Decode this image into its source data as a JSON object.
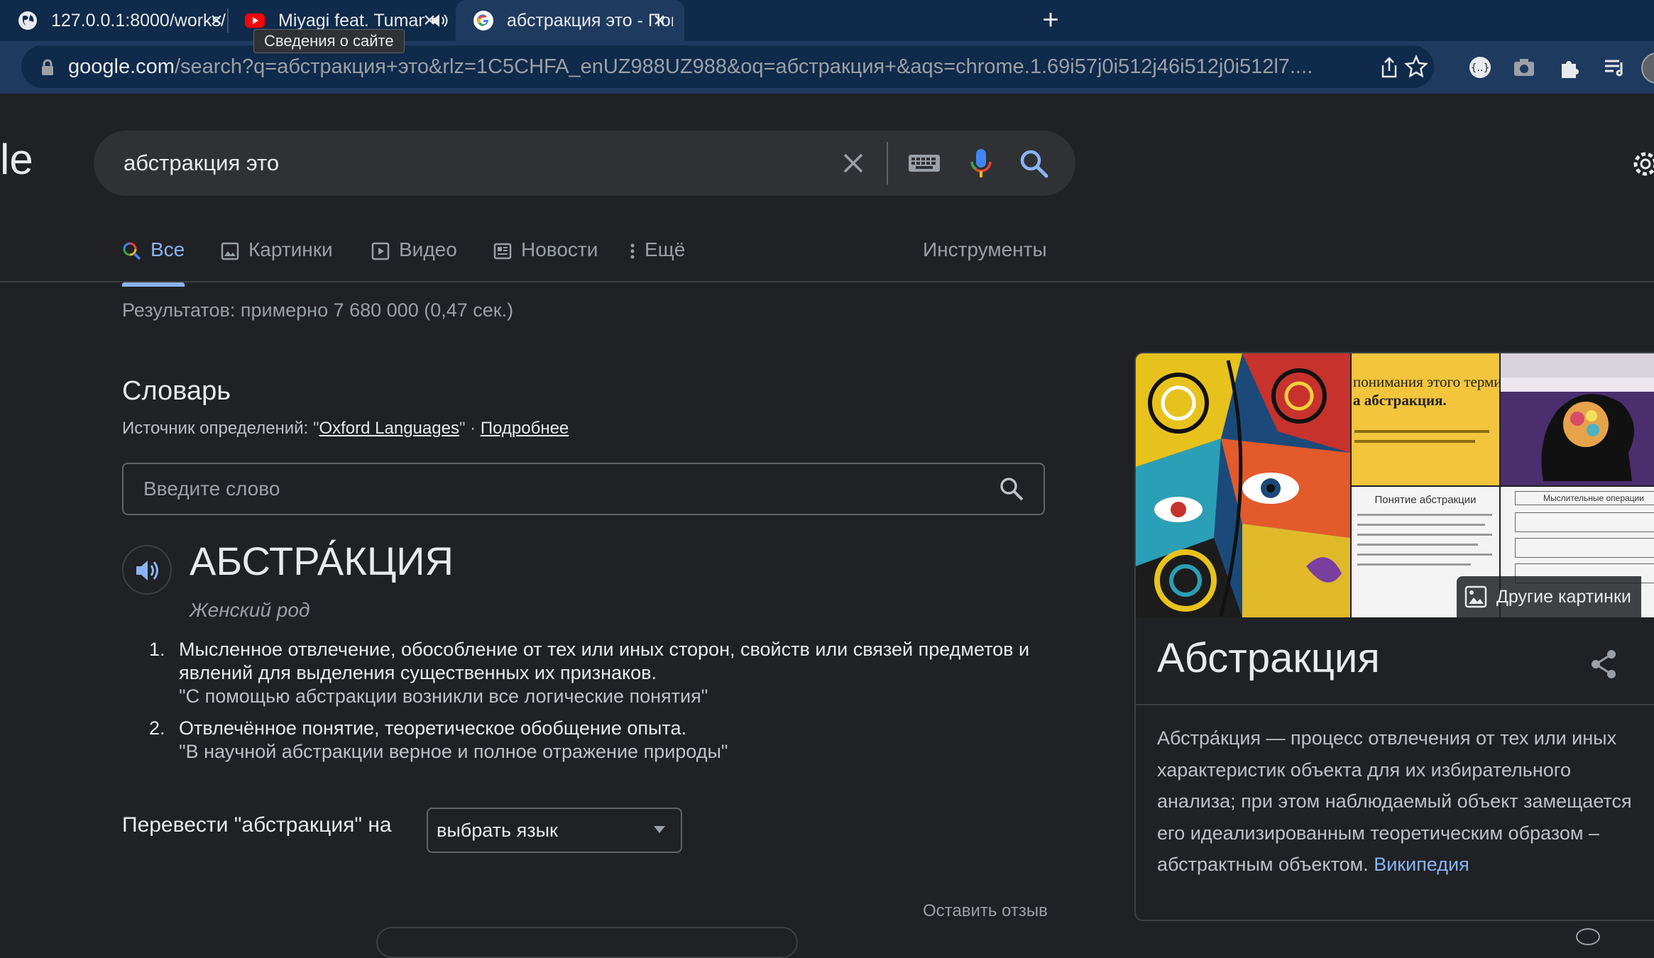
{
  "browser": {
    "tabs": [
      {
        "title": "127.0.0.1:8000/works/",
        "favicon": "globe-icon"
      },
      {
        "title": "Miyagi feat. TumaniYO, KAI",
        "favicon": "youtube-icon",
        "audio": "speaker-icon"
      },
      {
        "title": "абстракция это - Поиск в Google",
        "favicon": "google-icon",
        "active": true
      }
    ],
    "tooltip": "Сведения о сайте",
    "address_host": "google.com",
    "address_path": "/search?q=абстракция+это&rlz=1C5CHFA_enUZ988UZ988&oq=абстракция+&aqs=chrome.1.69i57j0i512j46i512j0i512l7...."
  },
  "search": {
    "logo_fragment": "le",
    "query": "абстракция это",
    "tabs": [
      {
        "label": "Все",
        "icon": "google-search-icon",
        "active": true
      },
      {
        "label": "Картинки",
        "icon": "image-icon"
      },
      {
        "label": "Видео",
        "icon": "play-icon"
      },
      {
        "label": "Новости",
        "icon": "news-icon"
      },
      {
        "label": "Ещё",
        "icon": "more-vert-icon"
      }
    ],
    "tools_label": "Инструменты",
    "result_stats": "Результатов: примерно 7 680 000 (0,47 сек.)"
  },
  "dictionary": {
    "title": "Словарь",
    "source_prefix": "Источник определений: \"",
    "source_link": "Oxford Languages",
    "source_suffix": "\" · ",
    "more_link": "Подробнее",
    "input_placeholder": "Введите слово",
    "headword": "АБСТРА́КЦИЯ",
    "gender": "Женский род",
    "definitions": [
      {
        "num": "1.",
        "text": "Мысленное отвлечение, обособление от тех или иных сторон, свойств или связей предметов и явлений для выделения существенных их признаков.",
        "example": "\"С помощью абстракции возникли все логические понятия\""
      },
      {
        "num": "2.",
        "text": "Отвлечённое понятие, теоретическое обобщение опыта.",
        "example": "\"В научной абстракции верное и полное отражение природы\""
      }
    ],
    "translate_label": "Перевести \"абстракция\" на",
    "language_select": "выбрать язык",
    "feedback": "Оставить отзыв"
  },
  "knowledge_panel": {
    "more_images": "Другие картинки",
    "image2_text": [
      "понимания этого терми",
      "а абстракция."
    ],
    "image4_text": "Понятие абстракции",
    "image5_text": "Мыслительные операции",
    "title": "Абстракция",
    "description": "Абстра́кция — процесс отвлечения от тех или иных характеристик объекта для их избирательного анализа; при этом наблюдаемый объект замеща­ется его идеализированным теоретическим обра­зом – абстрактным объектом.",
    "source_link": "Википедия"
  },
  "colors": {
    "background": "#202124",
    "link": "#8ab4f8",
    "tab_active": "#1e3a5f"
  }
}
